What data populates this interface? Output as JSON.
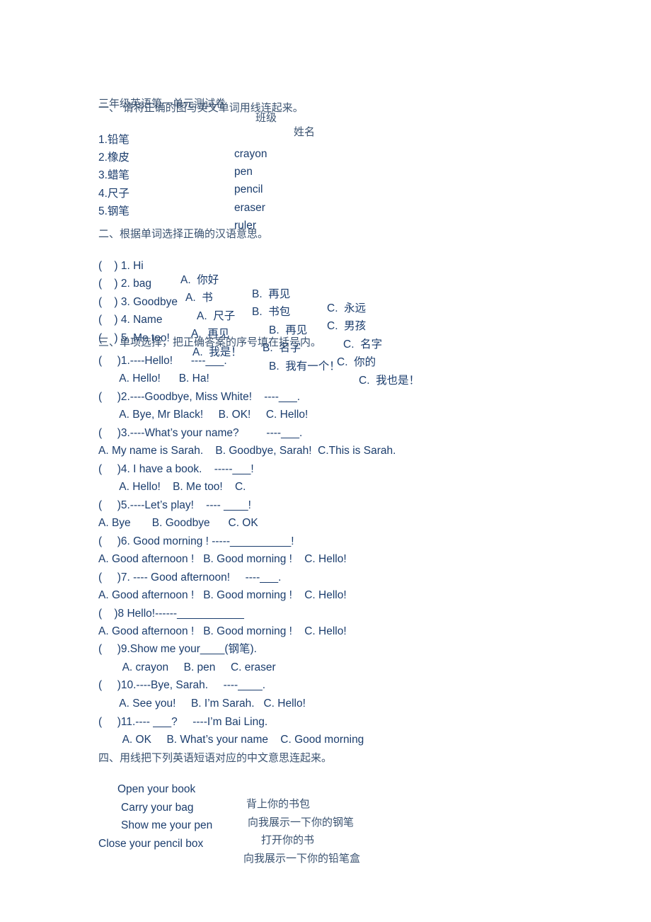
{
  "header": {
    "title": "三年级英语第一单元测试卷",
    "class_label": "班级",
    "name_label": "姓名"
  },
  "section1": {
    "heading": "一、 请将正确的图与英文单词用线连起来。",
    "left": [
      "1.铅笔",
      "2.橡皮",
      "3.蜡笔",
      "4.尺子",
      "5.钢笔"
    ],
    "right": [
      "crayon",
      "pen",
      "pencil",
      "eraser",
      "ruler"
    ]
  },
  "section2": {
    "heading": "二、根据单词选择正确的汉语意思。",
    "items": [
      {
        "q": "(    ) 1. Hi",
        "a": "A.  你好",
        "b": "B.  再见",
        "c": "C.  永远"
      },
      {
        "q": "(    ) 2. bag",
        "a": "A.  书",
        "b": "B.  书包",
        "c": "C.  男孩"
      },
      {
        "q": "(    ) 3. Goodbye",
        "a": "A.  尺子",
        "b": "B.  再见",
        "c": "C.  名字"
      },
      {
        "q": "(    ) 4. Name",
        "a": "A.  再见",
        "b": "B.  名字",
        "c": "C.  你的"
      },
      {
        "q": "(    ) 5. Me too!",
        "a": "A.  我是！",
        "b": "B.  我有一个！",
        "c": "C.  我也是！"
      }
    ]
  },
  "section3": {
    "heading": "三、单项选择，把正确答案的序号填在括号内。",
    "lines": [
      "(     )1.----Hello!      ----___.",
      "       A. Hello!      B. Ha!",
      "(     )2.----Goodbye, Miss White!    ----___.",
      "       A. Bye, Mr Black!     B. OK!     C. Hello!",
      "(     )3.----What’s your name?         ----___.",
      "A. My name is Sarah.    B. Goodbye, Sarah!  C.This is Sarah.",
      "(     )4. I have a book.    -----___!",
      "       A. Hello!    B. Me too!    C.",
      "(     )5.----Let’s play!    ---- ____!",
      "A. Bye       B. Goodbye      C. OK",
      "(     )6. Good morning ! -----__________!",
      "A. Good afternoon !   B. Good morning !    C. Hello!",
      "(     )7. ---- Good afternoon!     ----___.",
      "A. Good afternoon !   B. Good morning !    C. Hello!",
      "(    )8 Hello!------___________",
      "A. Good afternoon !   B. Good morning !    C. Hello!",
      "(     )9.Show me your____(钢笔).",
      "        A. crayon     B. pen     C. eraser",
      "(     )10.----Bye, Sarah.     ----____.",
      "       A. See you!     B. I’m Sarah.   C. Hello!",
      "(     )11.---- ___?     ----I’m Bai Ling.",
      "        A. OK     B. What’s your name    C. Good morning"
    ]
  },
  "section4": {
    "heading": "四、用线把下列英语短语对应的中文意思连起来。",
    "left": [
      "Open your book",
      "Carry your bag",
      "Show me your pen",
      "Close your pencil box"
    ],
    "right": [
      "背上你的书包",
      "向我展示一下你的钢笔",
      "打开你的书",
      "向我展示一下你的铅笔盒"
    ]
  }
}
